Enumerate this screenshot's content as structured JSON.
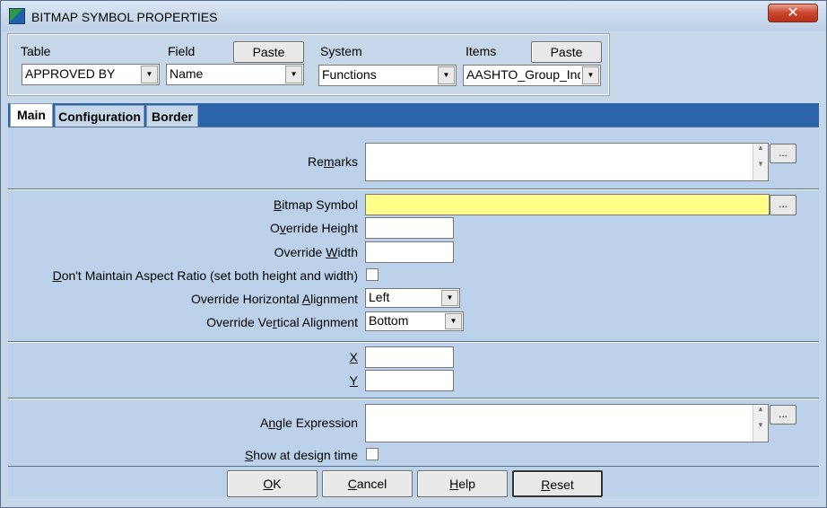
{
  "window": {
    "title": "BITMAP SYMBOL PROPERTIES",
    "close_glyph": "✕"
  },
  "fieldbar": {
    "table_label": "Table",
    "table_value": "APPROVED BY",
    "field_label": "Field",
    "field_paste": "Paste",
    "field_value": "Name",
    "system_label": "System",
    "system_value": "Functions",
    "items_label": "Items",
    "items_paste": "Paste",
    "items_value": "AASHTO_Group_Inde"
  },
  "tabs": [
    {
      "label": "Main"
    },
    {
      "label": "Configuration"
    },
    {
      "label": "Border"
    }
  ],
  "form": {
    "remarks_pre": "Re",
    "remarks_u": "m",
    "remarks_post": "arks",
    "bitmap_pre": "",
    "bitmap_u": "B",
    "bitmap_post": "itmap Symbol",
    "oh_pre": "O",
    "oh_u": "v",
    "oh_post": "erride Height",
    "ow_pre": "Override ",
    "ow_u": "W",
    "ow_post": "idth",
    "aspect_pre": "",
    "aspect_u": "D",
    "aspect_post": "on't Maintain Aspect Ratio (set both height and width)",
    "ha_pre": "Override Horizontal ",
    "ha_u": "A",
    "ha_post": "lignment",
    "ha_value": "Left",
    "va_pre": "Override Ve",
    "va_u": "r",
    "va_post": "tical Alignment",
    "va_value": "Bottom",
    "x_label": "X",
    "y_label": "Y",
    "angle_pre": "A",
    "angle_u": "n",
    "angle_post": "gle Expression",
    "show_pre": "",
    "show_u": "S",
    "show_post": "how at design time",
    "ellipsis": "..."
  },
  "buttons": {
    "ok_u": "O",
    "ok_post": "K",
    "cancel_u": "C",
    "cancel_post": "ancel",
    "help_u": "H",
    "help_post": "elp",
    "reset_u": "R",
    "reset_post": "eset"
  }
}
